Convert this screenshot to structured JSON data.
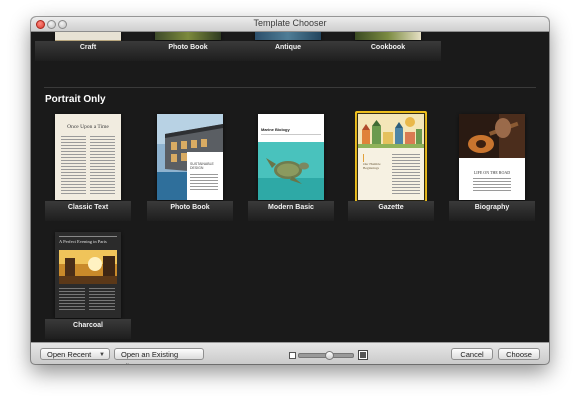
{
  "window": {
    "title": "Template Chooser"
  },
  "top_row": [
    {
      "label": "Craft"
    },
    {
      "label": "Photo Book"
    },
    {
      "label": "Antique"
    },
    {
      "label": "Cookbook"
    }
  ],
  "section": {
    "title": "Portrait Only"
  },
  "templates": [
    {
      "label": "Classic Text",
      "thumb_title": "Once Upon a Time"
    },
    {
      "label": "Photo Book",
      "thumb_title": "SUSTAINABLE DESIGN"
    },
    {
      "label": "Modern Basic",
      "thumb_title": "Marine Biology"
    },
    {
      "label": "Gazette",
      "thumb_title": "Our Humble Beginnings",
      "selected": true
    },
    {
      "label": "Biography",
      "thumb_title": "LIFE ON THE ROAD"
    },
    {
      "label": "Charcoal",
      "thumb_title": "A Perfect Evening in Paris"
    }
  ],
  "footer": {
    "open_recent": "Open Recent",
    "open_existing": "Open an Existing File...",
    "cancel": "Cancel",
    "choose": "Choose"
  },
  "colors": {
    "selection": "#f2c31f",
    "background": "#1a1a1a"
  }
}
